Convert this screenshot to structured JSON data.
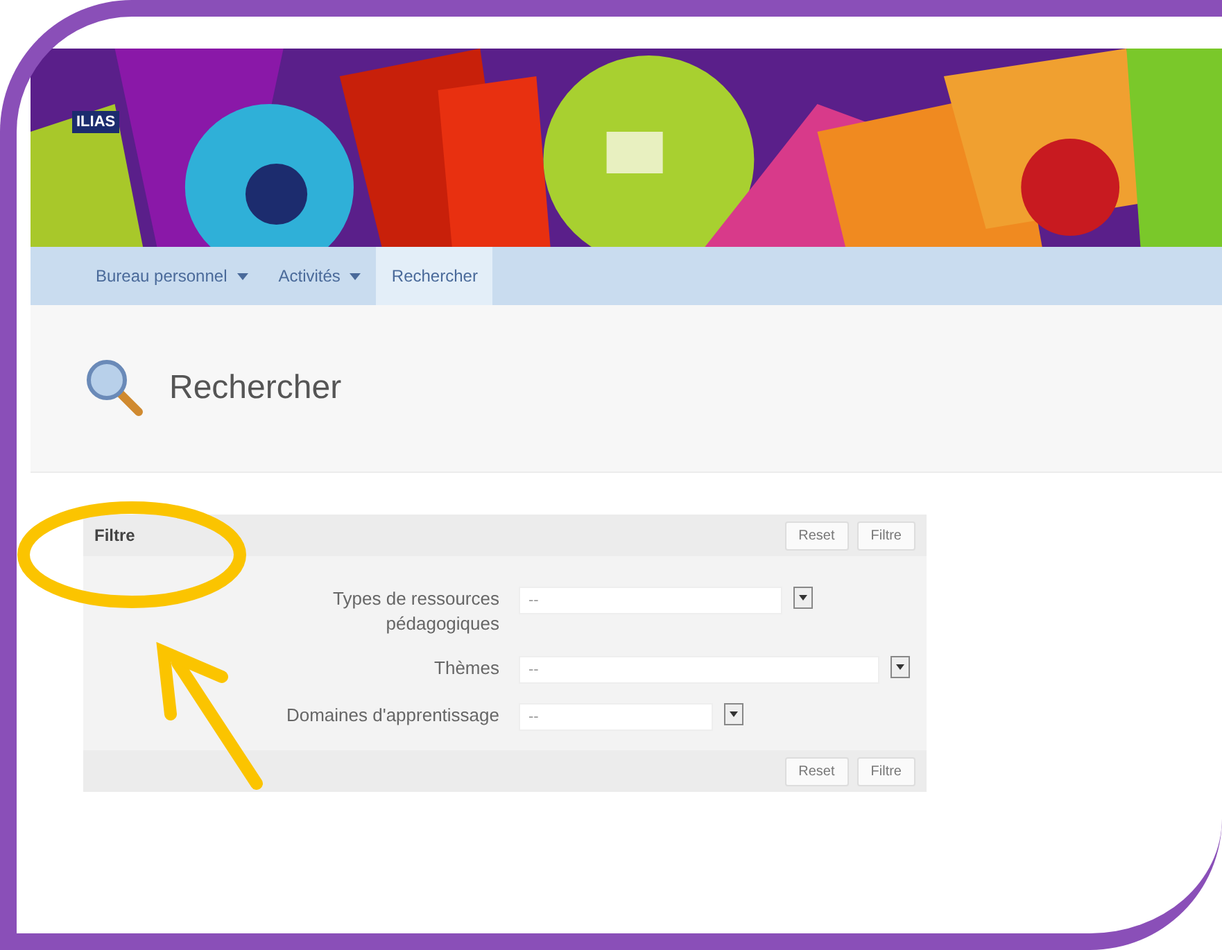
{
  "logo": "ILIAS",
  "menu": [
    {
      "label": "Bureau personnel",
      "dropdown": true,
      "selected": false
    },
    {
      "label": "Activités",
      "dropdown": true,
      "selected": false
    },
    {
      "label": "Rechercher",
      "dropdown": false,
      "selected": true
    }
  ],
  "page_title": "Rechercher",
  "filter": {
    "title": "Filtre",
    "top_buttons": [
      "Reset",
      "Filtre"
    ],
    "fields": [
      {
        "label": "Types de ressources pédagogiques",
        "value": "--"
      },
      {
        "label": "Thèmes",
        "value": "--"
      },
      {
        "label": "Domaines d'apprentissage",
        "value": "--"
      }
    ],
    "bottom_buttons": [
      "Reset",
      "Filtre"
    ]
  }
}
